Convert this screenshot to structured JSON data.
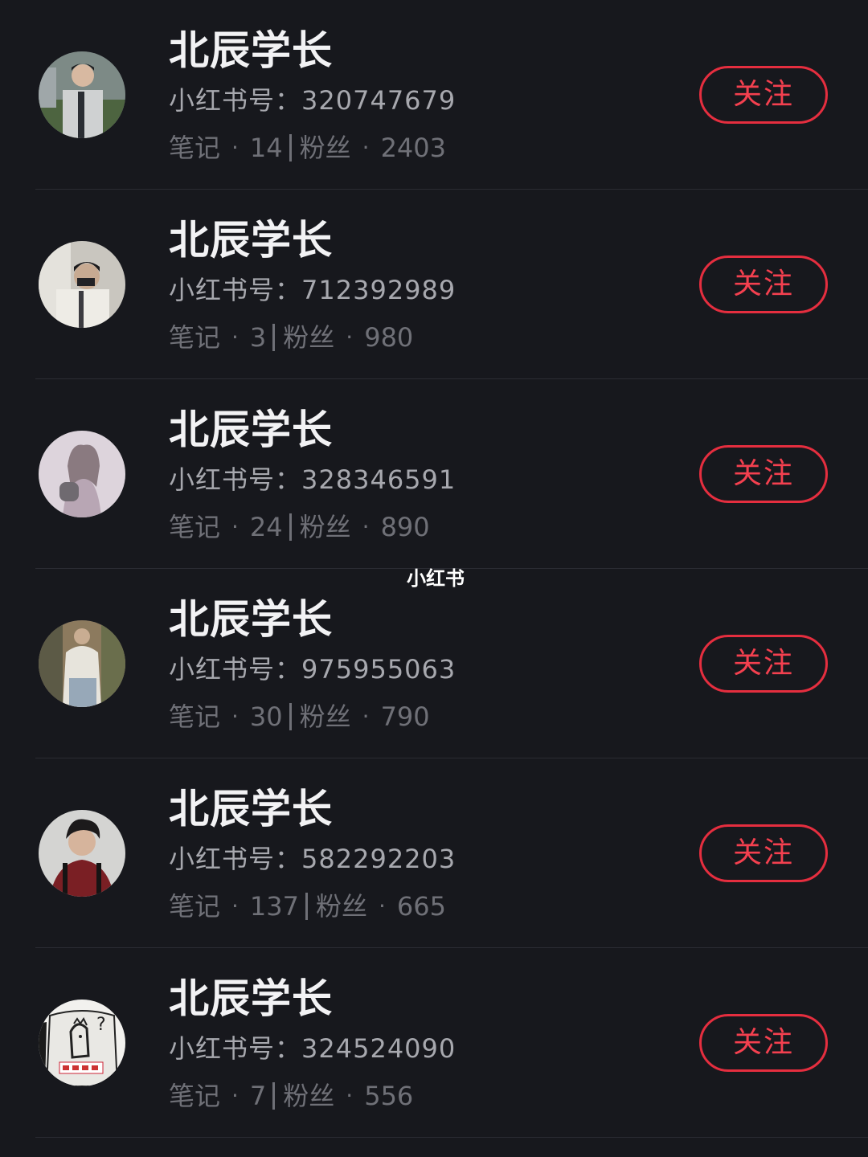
{
  "watermark": "小红书",
  "users": [
    {
      "name": "北辰学长",
      "id_label": "小红书号：",
      "id": "320747679",
      "notes_label": "笔记",
      "notes": "14",
      "fans_label": "粉丝",
      "fans": "2403",
      "follow_label": "关注",
      "avatar": "avatar-photo"
    },
    {
      "name": "北辰学长",
      "id_label": "小红书号：",
      "id": "712392989",
      "notes_label": "笔记",
      "notes": "3",
      "fans_label": "粉丝",
      "fans": "980",
      "follow_label": "关注",
      "avatar": "avatar-photo"
    },
    {
      "name": "北辰学长",
      "id_label": "小红书号：",
      "id": "328346591",
      "notes_label": "笔记",
      "notes": "24",
      "fans_label": "粉丝",
      "fans": "890",
      "follow_label": "关注",
      "avatar": "avatar-photo"
    },
    {
      "name": "北辰学长",
      "id_label": "小红书号：",
      "id": "975955063",
      "notes_label": "笔记",
      "notes": "30",
      "fans_label": "粉丝",
      "fans": "790",
      "follow_label": "关注",
      "avatar": "avatar-photo"
    },
    {
      "name": "北辰学长",
      "id_label": "小红书号：",
      "id": "582292203",
      "notes_label": "笔记",
      "notes": "137",
      "fans_label": "粉丝",
      "fans": "665",
      "follow_label": "关注",
      "avatar": "avatar-photo"
    },
    {
      "name": "北辰学长",
      "id_label": "小红书号：",
      "id": "324524090",
      "notes_label": "笔记",
      "notes": "7",
      "fans_label": "粉丝",
      "fans": "556",
      "follow_label": "关注",
      "avatar": "avatar-drawing"
    }
  ],
  "colors": {
    "background": "#17181d",
    "name": "#f2f2f4",
    "id_text": "#a7a8ae",
    "stats_text": "#6f7077",
    "follow_accent": "#e52e3f",
    "divider": "#2b2c33"
  }
}
